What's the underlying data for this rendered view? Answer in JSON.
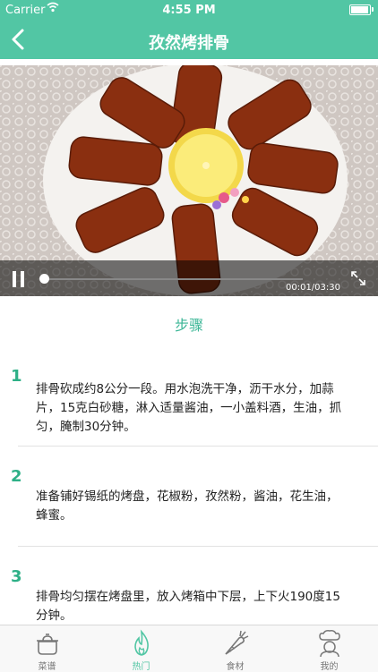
{
  "status_bar": {
    "carrier": "Carrier",
    "time": "4:55 PM"
  },
  "nav": {
    "title": "孜然烤排骨"
  },
  "video": {
    "timecode": "00:01/03:30",
    "progress": 0.005
  },
  "steps_heading": "步骤",
  "steps": [
    {
      "number": "1",
      "text": "排骨砍成约8公分一段。用水泡洗干净，沥干水分，加蒜片，15克白砂糖，淋入适量酱油，一小盖料酒，生油，抓匀，腌制30分钟。"
    },
    {
      "number": "2",
      "text": "准备铺好锡纸的烤盘，花椒粉，孜然粉，酱油，花生油，蜂蜜。"
    },
    {
      "number": "3",
      "text": "排骨均匀摆在烤盘里，放入烤箱中下层，上下火190度15分钟。"
    }
  ],
  "tabs": [
    {
      "label": "菜谱",
      "icon": "pot-icon"
    },
    {
      "label": "热门",
      "icon": "flame-icon"
    },
    {
      "label": "食材",
      "icon": "carrot-icon"
    },
    {
      "label": "我的",
      "icon": "chef-icon"
    }
  ],
  "colors": {
    "accent": "#52c6a4",
    "step_number": "#2eb087"
  }
}
